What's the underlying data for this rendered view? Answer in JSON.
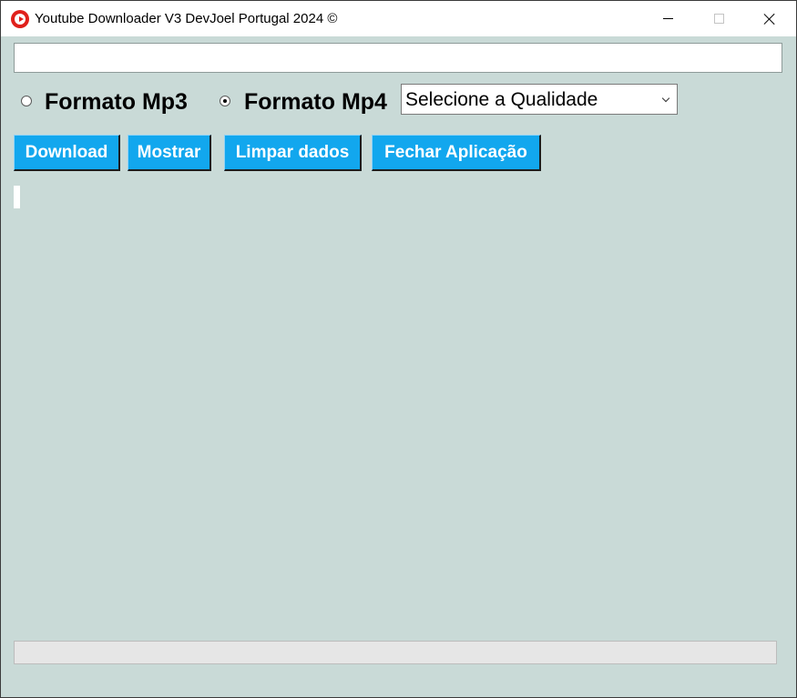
{
  "window": {
    "title": "Youtube Downloader V3 DevJoel Portugal 2024 ©",
    "icon": "youtube-play-icon",
    "controls": [
      "minimize-icon",
      "maximize-icon",
      "close-icon"
    ]
  },
  "url_input": {
    "value": "",
    "placeholder": ""
  },
  "format": {
    "options": [
      {
        "label": "Formato Mp3",
        "checked": false
      },
      {
        "label": "Formato Mp4",
        "checked": true
      }
    ]
  },
  "quality": {
    "selected": "Selecione a Qualidade"
  },
  "buttons": {
    "download": "Download",
    "mostrar": "Mostrar",
    "limpar": "Limpar dados",
    "fechar": "Fechar Aplicação"
  },
  "progress": {
    "value": 0
  },
  "colors": {
    "background": "#c9dad7",
    "button": "#12a7ee",
    "button_text": "#ffffff",
    "progress_fill": "#06b025"
  }
}
